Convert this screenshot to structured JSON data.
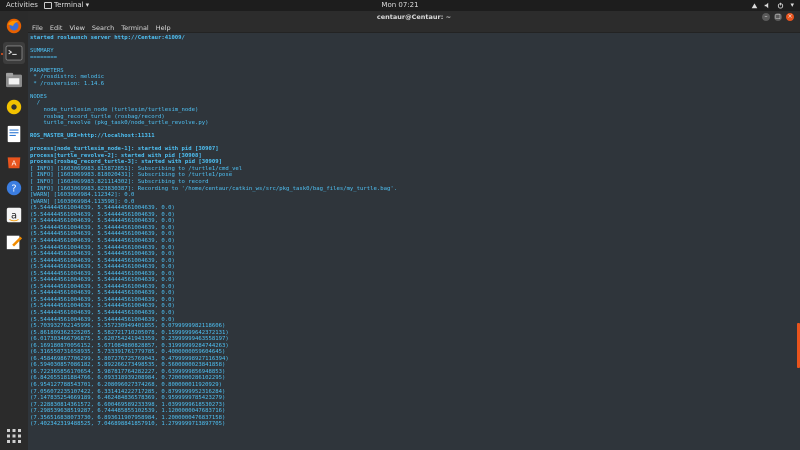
{
  "topbar": {
    "activities": "Activities",
    "app_name": "Terminal",
    "clock": "Mon 07:21"
  },
  "window": {
    "title": "centaur@Centaur: ~"
  },
  "menu": [
    "File",
    "Edit",
    "View",
    "Search",
    "Terminal",
    "Help"
  ],
  "dock": [
    "firefox-icon",
    "files-icon",
    "rhythmbox-icon",
    "writer-icon",
    "software-icon",
    "help-icon",
    "amazon-icon",
    "editor-icon",
    "show-apps-icon"
  ],
  "terminal_lines": [
    {
      "t": "started roslaunch server http://Centaur:41009/",
      "c": "b"
    },
    {
      "t": "",
      "c": ""
    },
    {
      "t": "SUMMARY",
      "c": ""
    },
    {
      "t": "========",
      "c": ""
    },
    {
      "t": "",
      "c": ""
    },
    {
      "t": "PARAMETERS",
      "c": ""
    },
    {
      "t": " * /rosdistro: melodic",
      "c": ""
    },
    {
      "t": " * /rosversion: 1.14.6",
      "c": ""
    },
    {
      "t": "",
      "c": ""
    },
    {
      "t": "NODES",
      "c": ""
    },
    {
      "t": "  /",
      "c": ""
    },
    {
      "t": "    node_turtlesim_node (turtlesim/turtlesim_node)",
      "c": ""
    },
    {
      "t": "    rosbag_record_turtle (rosbag/record)",
      "c": ""
    },
    {
      "t": "    turtle_revolve (pkg_task0/node_turtle_revolve.py)",
      "c": ""
    },
    {
      "t": "",
      "c": ""
    },
    {
      "t": "ROS_MASTER_URI=http://localhost:11311",
      "c": "b"
    },
    {
      "t": "",
      "c": ""
    },
    {
      "t": "process[node_turtlesim_node-1]: started with pid [30907]",
      "c": "b"
    },
    {
      "t": "process[turtle_revolve-2]: started with pid [30908]",
      "c": "b"
    },
    {
      "t": "process[rosbag_record_turtle-3]: started with pid [30909]",
      "c": "b"
    },
    {
      "t": "[ INFO] [1603069983.815872851]: Subscribing to /turtle1/cmd_vel",
      "c": ""
    },
    {
      "t": "[ INFO] [1603069983.818020431]: Subscribing to /turtle1/pose",
      "c": ""
    },
    {
      "t": "[ INFO] [1603069983.821114302]: Subscribing to record",
      "c": ""
    },
    {
      "t": "[ INFO] [1603069983.823830387]: Recording to '/home/centaur/catkin_ws/src/pkg_task0/bag_files/my_turtle.bag'.",
      "c": ""
    },
    {
      "t": "[WARN] [1603069984.112342]: 0.0",
      "c": "warn"
    },
    {
      "t": "[WARN] [1603069984.113598]: 0.0",
      "c": "warn"
    },
    {
      "t": "(5.544444561004639, 5.544444561004639, 0.0)",
      "c": "num"
    },
    {
      "t": "(5.544444561004639, 5.544444561004639, 0.0)",
      "c": "num"
    },
    {
      "t": "(5.544444561004639, 5.544444561004639, 0.0)",
      "c": "num"
    },
    {
      "t": "(5.544444561004639, 5.544444561004639, 0.0)",
      "c": "num"
    },
    {
      "t": "(5.544444561004639, 5.544444561004639, 0.0)",
      "c": "num"
    },
    {
      "t": "(5.544444561004639, 5.544444561004639, 0.0)",
      "c": "num"
    },
    {
      "t": "(5.544444561004639, 5.544444561004639, 0.0)",
      "c": "num"
    },
    {
      "t": "(5.544444561004639, 5.544444561004639, 0.0)",
      "c": "num"
    },
    {
      "t": "(5.544444561004639, 5.544444561004639, 0.0)",
      "c": "num"
    },
    {
      "t": "(5.544444561004639, 5.544444561004639, 0.0)",
      "c": "num"
    },
    {
      "t": "(5.544444561004639, 5.544444561004639, 0.0)",
      "c": "num"
    },
    {
      "t": "(5.544444561004639, 5.544444561004639, 0.0)",
      "c": "num"
    },
    {
      "t": "(5.544444561004639, 5.544444561004639, 0.0)",
      "c": "num"
    },
    {
      "t": "(5.544444561004639, 5.544444561004639, 0.0)",
      "c": "num"
    },
    {
      "t": "(5.544444561004639, 5.544444561004639, 0.0)",
      "c": "num"
    },
    {
      "t": "(5.544444561004639, 5.544444561004639, 0.0)",
      "c": "num"
    },
    {
      "t": "(5.544444561004639, 5.544444561004639, 0.0)",
      "c": "num"
    },
    {
      "t": "(5.544444561004639, 5.544444561004639, 0.0)",
      "c": "num"
    },
    {
      "t": "(5.703932762145996, 5.557230949401855, 0.0799999982118606)",
      "c": "num"
    },
    {
      "t": "(5.861809362325205, 5.582721710205078, 0.15999999642372131)",
      "c": "num"
    },
    {
      "t": "(6.017303466796875, 5.620754241943359, 0.23999999463558197)",
      "c": "num"
    },
    {
      "t": "(6.169180870056152, 5.671084880828857, 0.31999999284744263)",
      "c": "num"
    },
    {
      "t": "(6.316550731658935, 5.733391761779785, 0.4000000059604645)",
      "c": "num"
    },
    {
      "t": "(6.458469867706299, 5.807276725769043, 0.47999998927116394)",
      "c": "num"
    },
    {
      "t": "(6.594030857086182, 5.892266273498535, 0.5600000023841858)",
      "c": "num"
    },
    {
      "t": "(6.722365856170654, 5.987817764282227, 0.6399999856948853)",
      "c": "num"
    },
    {
      "t": "(6.842655181884766, 6.093318939208984, 0.7200000286102295)",
      "c": "num"
    },
    {
      "t": "(6.954127788543701, 6.208096027374268, 0.800000011920929)",
      "c": "num"
    },
    {
      "t": "(7.056072235107422, 6.331414222717285, 0.8799999952316284)",
      "c": "num"
    },
    {
      "t": "(7.147835254669189, 6.462484836578369, 0.9599999785423279)",
      "c": "num"
    },
    {
      "t": "(7.228830814361572, 6.600469589233398, 1.0399999618530273)",
      "c": "num"
    },
    {
      "t": "(7.298539638519287, 6.744485855102539, 1.1200000047683716)",
      "c": "num"
    },
    {
      "t": "(7.356516838073730, 6.893611907958984, 1.2000000476837158)",
      "c": "num"
    },
    {
      "t": "(7.402342319488525, 7.046898841857910, 1.2799999713897705)",
      "c": "num"
    }
  ]
}
